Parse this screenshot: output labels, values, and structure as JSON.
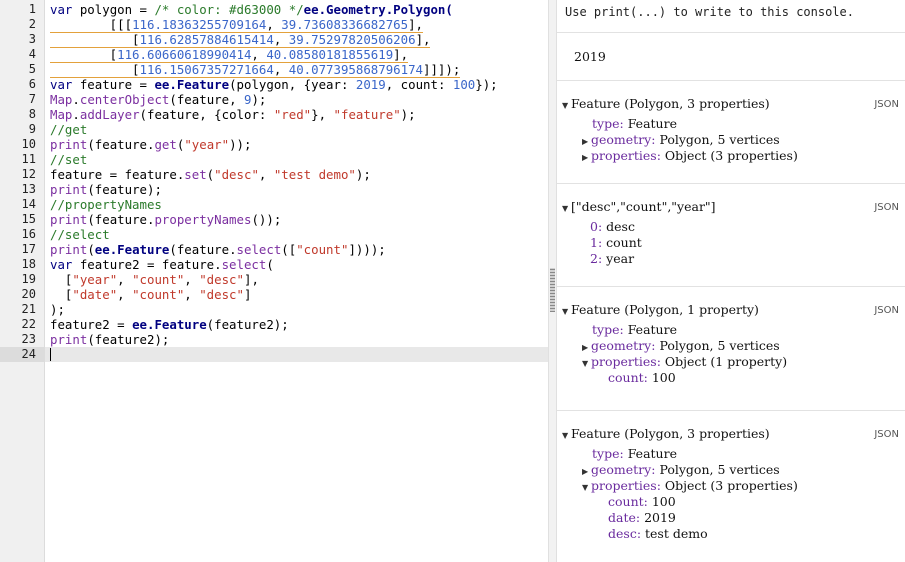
{
  "editor": {
    "line_numbers": [
      "1",
      "2",
      "3",
      "4",
      "5",
      "6",
      "7",
      "8",
      "9",
      "10",
      "11",
      "12",
      "13",
      "14",
      "15",
      "16",
      "17",
      "18",
      "19",
      "20",
      "21",
      "22",
      "23",
      "24"
    ],
    "lines": [
      [
        {
          "t": "var",
          "c": "kw"
        },
        {
          "t": " polygon = "
        },
        {
          "t": "/* color: #d63000 */",
          "c": "c"
        },
        {
          "t": "ee.Geometry.Polygon(",
          "c": "k"
        }
      ],
      [
        {
          "t": "        [[["
        },
        {
          "t": "116.18363255709164",
          "c": "n"
        },
        {
          "t": ", "
        },
        {
          "t": "39.73608336682765",
          "c": "n"
        },
        {
          "t": "],"
        }
      ],
      [
        {
          "t": "           ["
        },
        {
          "t": "116.62857884615414",
          "c": "n"
        },
        {
          "t": ", "
        },
        {
          "t": "39.75297820506206",
          "c": "n"
        },
        {
          "t": "],"
        }
      ],
      [
        {
          "t": "        ["
        },
        {
          "t": "116.60660618990414",
          "c": "n"
        },
        {
          "t": ", "
        },
        {
          "t": "40.08580181855619",
          "c": "n"
        },
        {
          "t": "],"
        }
      ],
      [
        {
          "t": "           ["
        },
        {
          "t": "116.15067357271664",
          "c": "n"
        },
        {
          "t": ", "
        },
        {
          "t": "40.077395868796174",
          "c": "n"
        },
        {
          "t": "]]]);"
        }
      ],
      [
        {
          "t": "var",
          "c": "kw"
        },
        {
          "t": " feature = "
        },
        {
          "t": "ee.Feature",
          "c": "k"
        },
        {
          "t": "(polygon, {year: "
        },
        {
          "t": "2019",
          "c": "n"
        },
        {
          "t": ", count: "
        },
        {
          "t": "100",
          "c": "n"
        },
        {
          "t": "});"
        }
      ],
      [
        {
          "t": "Map",
          "c": "f"
        },
        {
          "t": "."
        },
        {
          "t": "centerObject",
          "c": "f"
        },
        {
          "t": "(feature, "
        },
        {
          "t": "9",
          "c": "n"
        },
        {
          "t": ");"
        }
      ],
      [
        {
          "t": "Map",
          "c": "f"
        },
        {
          "t": "."
        },
        {
          "t": "addLayer",
          "c": "f"
        },
        {
          "t": "(feature, {color: "
        },
        {
          "t": "\"red\"",
          "c": "s"
        },
        {
          "t": "}, "
        },
        {
          "t": "\"feature\"",
          "c": "s"
        },
        {
          "t": ");"
        }
      ],
      [
        {
          "t": "//get",
          "c": "c"
        }
      ],
      [
        {
          "t": "print",
          "c": "f"
        },
        {
          "t": "(feature."
        },
        {
          "t": "get",
          "c": "f"
        },
        {
          "t": "("
        },
        {
          "t": "\"year\"",
          "c": "s"
        },
        {
          "t": "));"
        }
      ],
      [
        {
          "t": "//set",
          "c": "c"
        }
      ],
      [
        {
          "t": "feature = feature."
        },
        {
          "t": "set",
          "c": "f"
        },
        {
          "t": "("
        },
        {
          "t": "\"desc\"",
          "c": "s"
        },
        {
          "t": ", "
        },
        {
          "t": "\"test demo\"",
          "c": "s"
        },
        {
          "t": ");"
        }
      ],
      [
        {
          "t": "print",
          "c": "f"
        },
        {
          "t": "(feature);"
        }
      ],
      [
        {
          "t": "//propertyNames",
          "c": "c"
        }
      ],
      [
        {
          "t": "print",
          "c": "f"
        },
        {
          "t": "(feature."
        },
        {
          "t": "propertyNames",
          "c": "f"
        },
        {
          "t": "());"
        }
      ],
      [
        {
          "t": "//select",
          "c": "c"
        }
      ],
      [
        {
          "t": "print",
          "c": "f"
        },
        {
          "t": "("
        },
        {
          "t": "ee.Feature",
          "c": "k"
        },
        {
          "t": "(feature."
        },
        {
          "t": "select",
          "c": "f"
        },
        {
          "t": "(["
        },
        {
          "t": "\"count\"",
          "c": "s"
        },
        {
          "t": "])));"
        }
      ],
      [
        {
          "t": "var",
          "c": "kw"
        },
        {
          "t": " feature2 = feature."
        },
        {
          "t": "select",
          "c": "f"
        },
        {
          "t": "("
        }
      ],
      [
        {
          "t": "  ["
        },
        {
          "t": "\"year\"",
          "c": "s"
        },
        {
          "t": ", "
        },
        {
          "t": "\"count\"",
          "c": "s"
        },
        {
          "t": ", "
        },
        {
          "t": "\"desc\"",
          "c": "s"
        },
        {
          "t": "],"
        }
      ],
      [
        {
          "t": "  ["
        },
        {
          "t": "\"date\"",
          "c": "s"
        },
        {
          "t": ", "
        },
        {
          "t": "\"count\"",
          "c": "s"
        },
        {
          "t": ", "
        },
        {
          "t": "\"desc\"",
          "c": "s"
        },
        {
          "t": "]"
        }
      ],
      [
        {
          "t": ");"
        }
      ],
      [
        {
          "t": "feature2 = "
        },
        {
          "t": "ee.Feature",
          "c": "k"
        },
        {
          "t": "(feature2);"
        }
      ],
      [
        {
          "t": "print",
          "c": "f"
        },
        {
          "t": "(feature2);"
        }
      ],
      []
    ]
  },
  "console": {
    "hint": "Use print(...) to write to this console.",
    "out1": "2019",
    "json_label": "JSON",
    "b2": {
      "header": "Feature (Polygon, 3 properties)",
      "type_key": "type:",
      "type_val": "Feature",
      "geom_key": "geometry:",
      "geom_val": "Polygon, 5 vertices",
      "prop_key": "properties:",
      "prop_val": "Object (3 properties)"
    },
    "b3": {
      "header": "[\"desc\",\"count\",\"year\"]",
      "items": [
        {
          "k": "0:",
          "v": "desc"
        },
        {
          "k": "1:",
          "v": "count"
        },
        {
          "k": "2:",
          "v": "year"
        }
      ]
    },
    "b4": {
      "header": "Feature (Polygon, 1 property)",
      "type_key": "type:",
      "type_val": "Feature",
      "geom_key": "geometry:",
      "geom_val": "Polygon, 5 vertices",
      "prop_key": "properties:",
      "prop_val": "Object (1 property)",
      "sub": [
        {
          "k": "count:",
          "v": "100"
        }
      ]
    },
    "b5": {
      "header": "Feature (Polygon, 3 properties)",
      "type_key": "type:",
      "type_val": "Feature",
      "geom_key": "geometry:",
      "geom_val": "Polygon, 5 vertices",
      "prop_key": "properties:",
      "prop_val": "Object (3 properties)",
      "sub": [
        {
          "k": "count:",
          "v": "100"
        },
        {
          "k": "date:",
          "v": "2019"
        },
        {
          "k": "desc:",
          "v": "test demo"
        }
      ]
    }
  }
}
